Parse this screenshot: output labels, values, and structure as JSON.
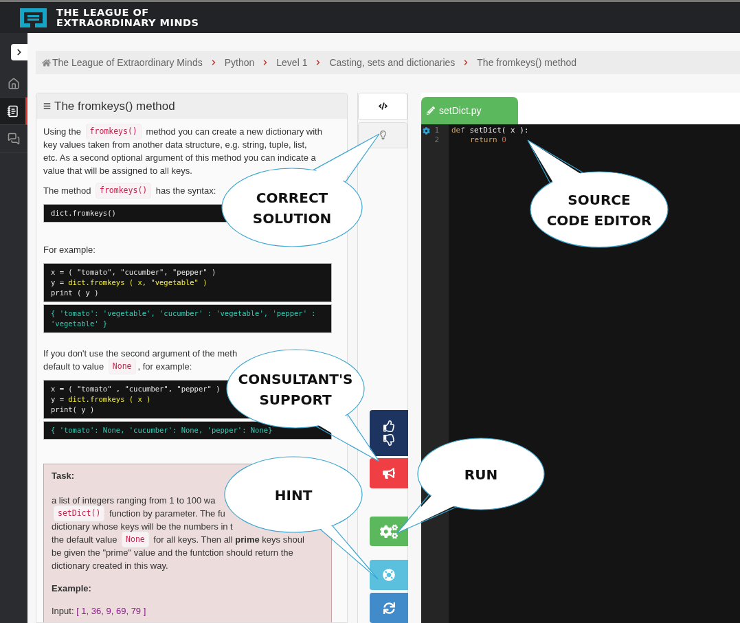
{
  "header": {
    "logo_lines": [
      "THE LEAGUE OF",
      "EXTRAORDINARY MINDS"
    ]
  },
  "sidebar": {
    "items": [
      {
        "kind": "home",
        "selected": false
      },
      {
        "kind": "notebook",
        "selected": true
      },
      {
        "kind": "chat",
        "selected": false
      }
    ]
  },
  "breadcrumb": [
    {
      "label": "The League of Extraordinary Minds",
      "kind": "home"
    },
    {
      "label": "Python",
      "kind": "plain"
    },
    {
      "label": "Level 1",
      "kind": "plain"
    },
    {
      "label": "Casting, sets and dictionaries",
      "kind": "plain"
    },
    {
      "label": "The fromkeys() method",
      "kind": "plain"
    }
  ],
  "lesson": {
    "title": "The fromkeys() method",
    "blocks": [
      {
        "kind": "paragraph",
        "lines": [
          [
            {
              "kind": "text",
              "text": "Using the "
            },
            {
              "kind": "code",
              "text": "fromkeys()"
            },
            {
              "kind": "text",
              "text": " method you can create a new dictionary with"
            }
          ],
          [
            {
              "kind": "text",
              "text": "key values taken from another data structure, e.g. string, tuple, list,"
            }
          ],
          [
            {
              "kind": "text",
              "text": "etc. As a second optional argument of this method you can indicate a"
            }
          ],
          [
            {
              "kind": "text",
              "text": "value that will be assigned to all keys."
            }
          ]
        ]
      },
      {
        "kind": "paragraph",
        "lines": [
          [
            {
              "kind": "text",
              "text": "The method "
            },
            {
              "kind": "code",
              "text": "fromkeys()"
            },
            {
              "kind": "text",
              "text": " has the syntax:"
            }
          ]
        ]
      },
      {
        "kind": "code",
        "lines": [
          [
            {
              "kind": "plain",
              "text": "dict.fromkeys()"
            }
          ]
        ]
      },
      {
        "kind": "paragraph",
        "lines": [
          [
            {
              "kind": "text",
              "text": "For example:"
            }
          ]
        ]
      },
      {
        "kind": "code",
        "lines": [
          [
            {
              "kind": "plain",
              "text": "x = ( \"tomato\", \"cucumber\", \"pepper\" )"
            }
          ],
          [
            {
              "kind": "plain",
              "text": "y = "
            },
            {
              "kind": "highlight",
              "text": "dict.fromkeys ( x, \"vegetable\" )"
            }
          ],
          [
            {
              "kind": "plain",
              "text": "print ( y )"
            }
          ]
        ]
      },
      {
        "kind": "output",
        "text": "{ 'tomato':  'vegetable', 'cucumber' : 'vegetable', 'pepper' : 'vegetable' }"
      },
      {
        "kind": "paragraph",
        "lines": [
          [
            {
              "kind": "text",
              "text": "If you don't use the second argument of the meth"
            }
          ],
          [
            {
              "kind": "text",
              "text": "default to value "
            },
            {
              "kind": "code",
              "text": "None"
            },
            {
              "kind": "text",
              "text": ", for example:"
            }
          ]
        ]
      },
      {
        "kind": "code",
        "lines": [
          [
            {
              "kind": "plain",
              "text": "x = ( \"tomato\" , \"cucumber\", \"pepper\" )"
            }
          ],
          [
            {
              "kind": "plain",
              "text": "y = "
            },
            {
              "kind": "highlight",
              "text": "dict.fromkeys ( x )"
            }
          ],
          [
            {
              "kind": "plain",
              "text": "print( y )"
            }
          ]
        ]
      },
      {
        "kind": "output",
        "text": "{ 'tomato': None, 'cucumber': None, 'pepper': None}"
      },
      {
        "kind": "task",
        "title": "Task:",
        "lines": [
          [
            {
              "kind": "text",
              "text": "a list of integers ranging from 1 to 100 wa"
            }
          ],
          [
            {
              "kind": "code",
              "text": "setDict()"
            },
            {
              "kind": "text",
              "text": " function by parameter. The fu"
            }
          ],
          [
            {
              "kind": "text",
              "text": "dictionary whose keys will be the numbers in t"
            }
          ],
          [
            {
              "kind": "text",
              "text": "the default value "
            },
            {
              "kind": "code",
              "text": "None"
            },
            {
              "kind": "text",
              "text": " for all keys. Then all **prime** keys shoul"
            }
          ],
          [
            {
              "kind": "text",
              "text": "be given the \"prime\" value and the funtction should return the"
            }
          ],
          [
            {
              "kind": "text",
              "text": "dictionary created in this way."
            }
          ]
        ],
        "example_title": "Example:",
        "input_label": "Input: ",
        "input_value": "[ 1, 36, 9, 69, 79 ]"
      }
    ]
  },
  "tools": {
    "tabs": [
      {
        "kind": "code",
        "selected": true
      },
      {
        "kind": "hint",
        "selected": false
      }
    ],
    "buttons": [
      {
        "kind": "feedback",
        "color": "#1d3461"
      },
      {
        "kind": "support",
        "color": "#ef3f44"
      },
      {
        "kind": "run",
        "color": "#5cb85c"
      },
      {
        "kind": "hint",
        "color": "#5bc0de"
      },
      {
        "kind": "reset",
        "color": "#428bca"
      }
    ]
  },
  "editor": {
    "file_tab": "setDict.py",
    "lines": [
      {
        "number": "1",
        "tokens": [
          {
            "kind": "keyword",
            "text": "def "
          },
          {
            "kind": "plain",
            "text": "setDict( x ):"
          }
        ]
      },
      {
        "number": "2",
        "indent": true,
        "tokens": [
          {
            "kind": "keyword",
            "text": "return "
          },
          {
            "kind": "number",
            "text": "0"
          }
        ]
      }
    ]
  },
  "callouts": [
    {
      "lines": [
        "CORRECT",
        "SOLUTION"
      ]
    },
    {
      "lines": [
        "SOURCE",
        "CODE EDITOR"
      ]
    },
    {
      "lines": [
        "CONSULTANT'S",
        "SUPPORT"
      ]
    },
    {
      "lines": [
        "RUN"
      ]
    },
    {
      "lines": [
        "HINT"
      ]
    }
  ]
}
